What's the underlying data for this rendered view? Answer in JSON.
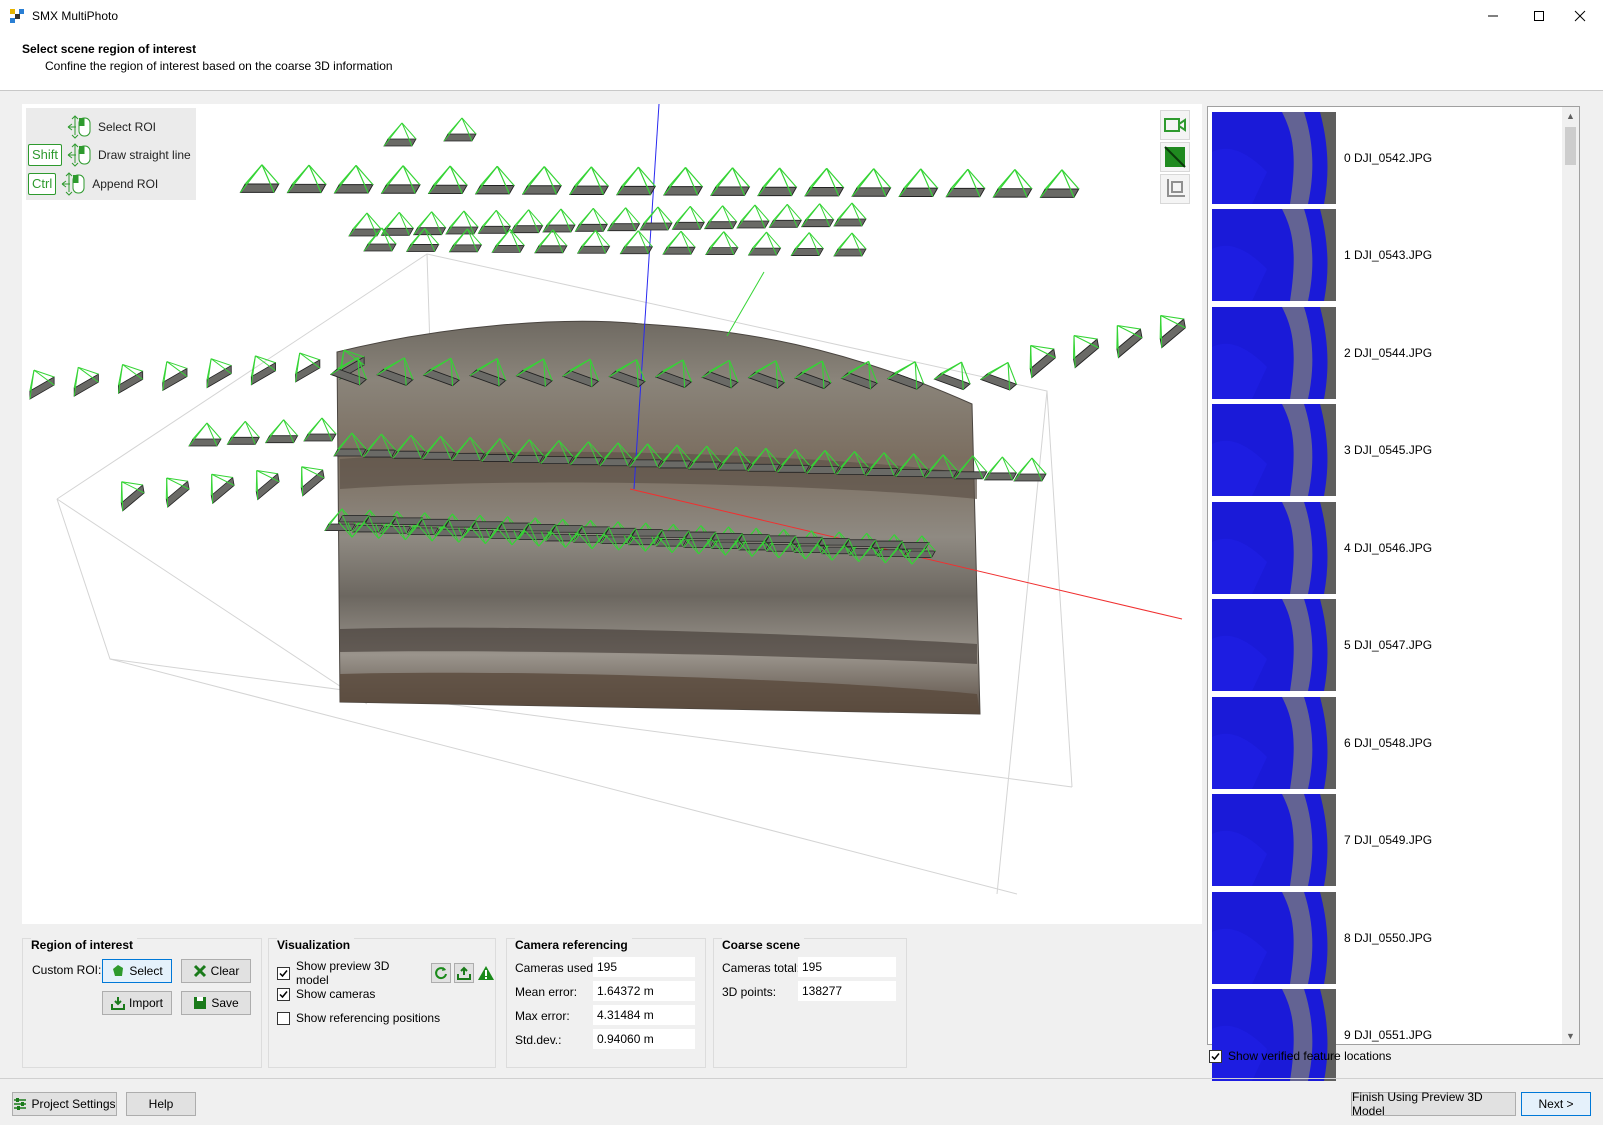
{
  "window": {
    "title": "SMX MultiPhoto"
  },
  "header": {
    "title": "Select scene region of interest",
    "subtitle": "Confine the region of interest based on the coarse 3D information"
  },
  "hints": [
    {
      "key": "",
      "label": "Select ROI"
    },
    {
      "key": "Shift",
      "label": "Draw straight line"
    },
    {
      "key": "Ctrl",
      "label": "Append ROI"
    }
  ],
  "thumbnails": [
    {
      "label": "0 DJI_0542.JPG"
    },
    {
      "label": "1 DJI_0543.JPG"
    },
    {
      "label": "2 DJI_0544.JPG"
    },
    {
      "label": "3 DJI_0545.JPG"
    },
    {
      "label": "4 DJI_0546.JPG"
    },
    {
      "label": "5 DJI_0547.JPG"
    },
    {
      "label": "6 DJI_0548.JPG"
    },
    {
      "label": "7 DJI_0549.JPG"
    },
    {
      "label": "8 DJI_0550.JPG"
    },
    {
      "label": "9 DJI_0551.JPG"
    }
  ],
  "show_verified": {
    "label": "Show verified feature locations",
    "checked": true
  },
  "roi": {
    "title": "Region of interest",
    "custom_label": "Custom ROI:",
    "select": "Select",
    "clear": "Clear",
    "import": "Import",
    "save": "Save"
  },
  "visualization": {
    "title": "Visualization",
    "preview": {
      "label": "Show preview 3D model",
      "checked": true
    },
    "cameras": {
      "label": "Show cameras",
      "checked": true
    },
    "referencing": {
      "label": "Show referencing positions",
      "checked": false
    }
  },
  "camera_referencing": {
    "title": "Camera referencing",
    "cameras_used_label": "Cameras used:",
    "cameras_used": "195",
    "mean_error_label": "Mean error:",
    "mean_error": "1.64372 m",
    "max_error_label": "Max error:",
    "max_error": "4.31484 m",
    "std_dev_label": "Std.dev.:",
    "std_dev": "0.94060 m"
  },
  "coarse_scene": {
    "title": "Coarse scene",
    "cameras_total_label": "Cameras total:",
    "cameras_total": "195",
    "points_label": "3D points:",
    "points": "138277"
  },
  "footer": {
    "project_settings": "Project Settings",
    "help": "Help",
    "finish": "Finish Using Preview 3D Model",
    "next": "Next >"
  },
  "colors": {
    "camera_frustum": "#35d435",
    "accent": "#0078d7",
    "feature_points": "#1a1ad8"
  }
}
